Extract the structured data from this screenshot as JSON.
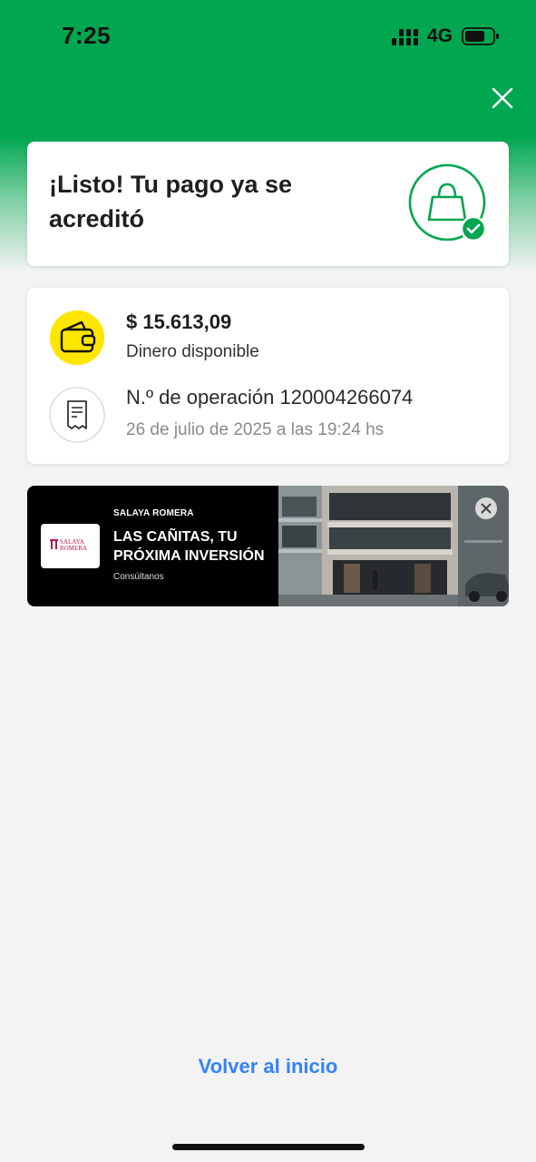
{
  "status_bar": {
    "time": "7:25",
    "network": "4G"
  },
  "colors": {
    "brand_green": "#00a650",
    "link_blue": "#3483fa",
    "wallet_yellow": "#ffe600"
  },
  "success": {
    "title": "¡Listo! Tu pago ya se acreditó",
    "icon": "shopping-bag-check-icon"
  },
  "payment": {
    "amount": "$ 15.613,09",
    "amount_label": "Dinero disponible",
    "operation": "N.º de operación 120004266074",
    "date": "26 de julio de 2025 a las 19:24 hs"
  },
  "ad": {
    "logo_text_1": "SALAYA",
    "logo_text_2": "ROMERA",
    "brand": "SALAYA ROMERA",
    "headline": "LAS CAÑITAS, TU PRÓXIMA INVERSIÓN",
    "cta": "Consúltanos"
  },
  "footer": {
    "home_link": "Volver al inicio"
  }
}
